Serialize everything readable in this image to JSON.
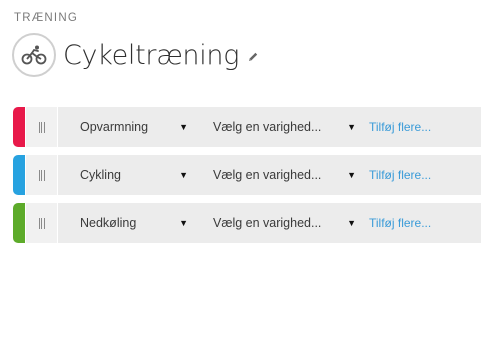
{
  "header": {
    "section_label": "TRÆNING",
    "title": "Cykeltræning",
    "avatar_icon": "bicycle-icon",
    "edit_icon": "pencil-icon"
  },
  "rows": [
    {
      "activity": "Opvarmning",
      "duration_placeholder": "Vælg en varighed...",
      "add_more": "Tilføj flere...",
      "color": "#e8194a"
    },
    {
      "activity": "Cykling",
      "duration_placeholder": "Vælg en varighed...",
      "add_more": "Tilføj flere...",
      "color": "#27a2e0"
    },
    {
      "activity": "Nedkøling",
      "duration_placeholder": "Vælg en varighed...",
      "add_more": "Tilføj flere...",
      "color": "#5dab2a"
    }
  ],
  "icons": {
    "drag_handle": "drag-handle-icon",
    "caret": "caret-down-icon"
  }
}
